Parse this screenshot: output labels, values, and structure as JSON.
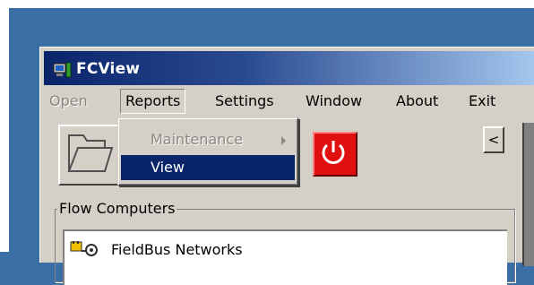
{
  "window": {
    "title": "FCView"
  },
  "menubar": {
    "items": [
      {
        "label": "Open",
        "state": "disabled"
      },
      {
        "label": "Reports",
        "state": "active"
      },
      {
        "label": "Settings",
        "state": "normal"
      },
      {
        "label": "Window",
        "state": "normal"
      },
      {
        "label": "About",
        "state": "normal"
      },
      {
        "label": "Exit",
        "state": "normal"
      }
    ]
  },
  "submenu": {
    "items": [
      {
        "label": "Maintenance",
        "state": "disabled",
        "has_submenu": true
      },
      {
        "label": "View",
        "state": "highlighted",
        "has_submenu": false
      }
    ]
  },
  "toolbar": {
    "open_icon": "folder-icon",
    "power_icon": "power-icon",
    "back_label": "<"
  },
  "flow_computers": {
    "group_label": "Flow Computers",
    "items": [
      {
        "label": "FieldBus Networks",
        "icon": "network-icon"
      }
    ]
  },
  "colors": {
    "desktop": "#3a6ea5",
    "face": "#d4d0c8",
    "title_start": "#0a246a",
    "title_end": "#a6caf0",
    "highlight": "#0a246a",
    "power_red": "#e01010"
  }
}
